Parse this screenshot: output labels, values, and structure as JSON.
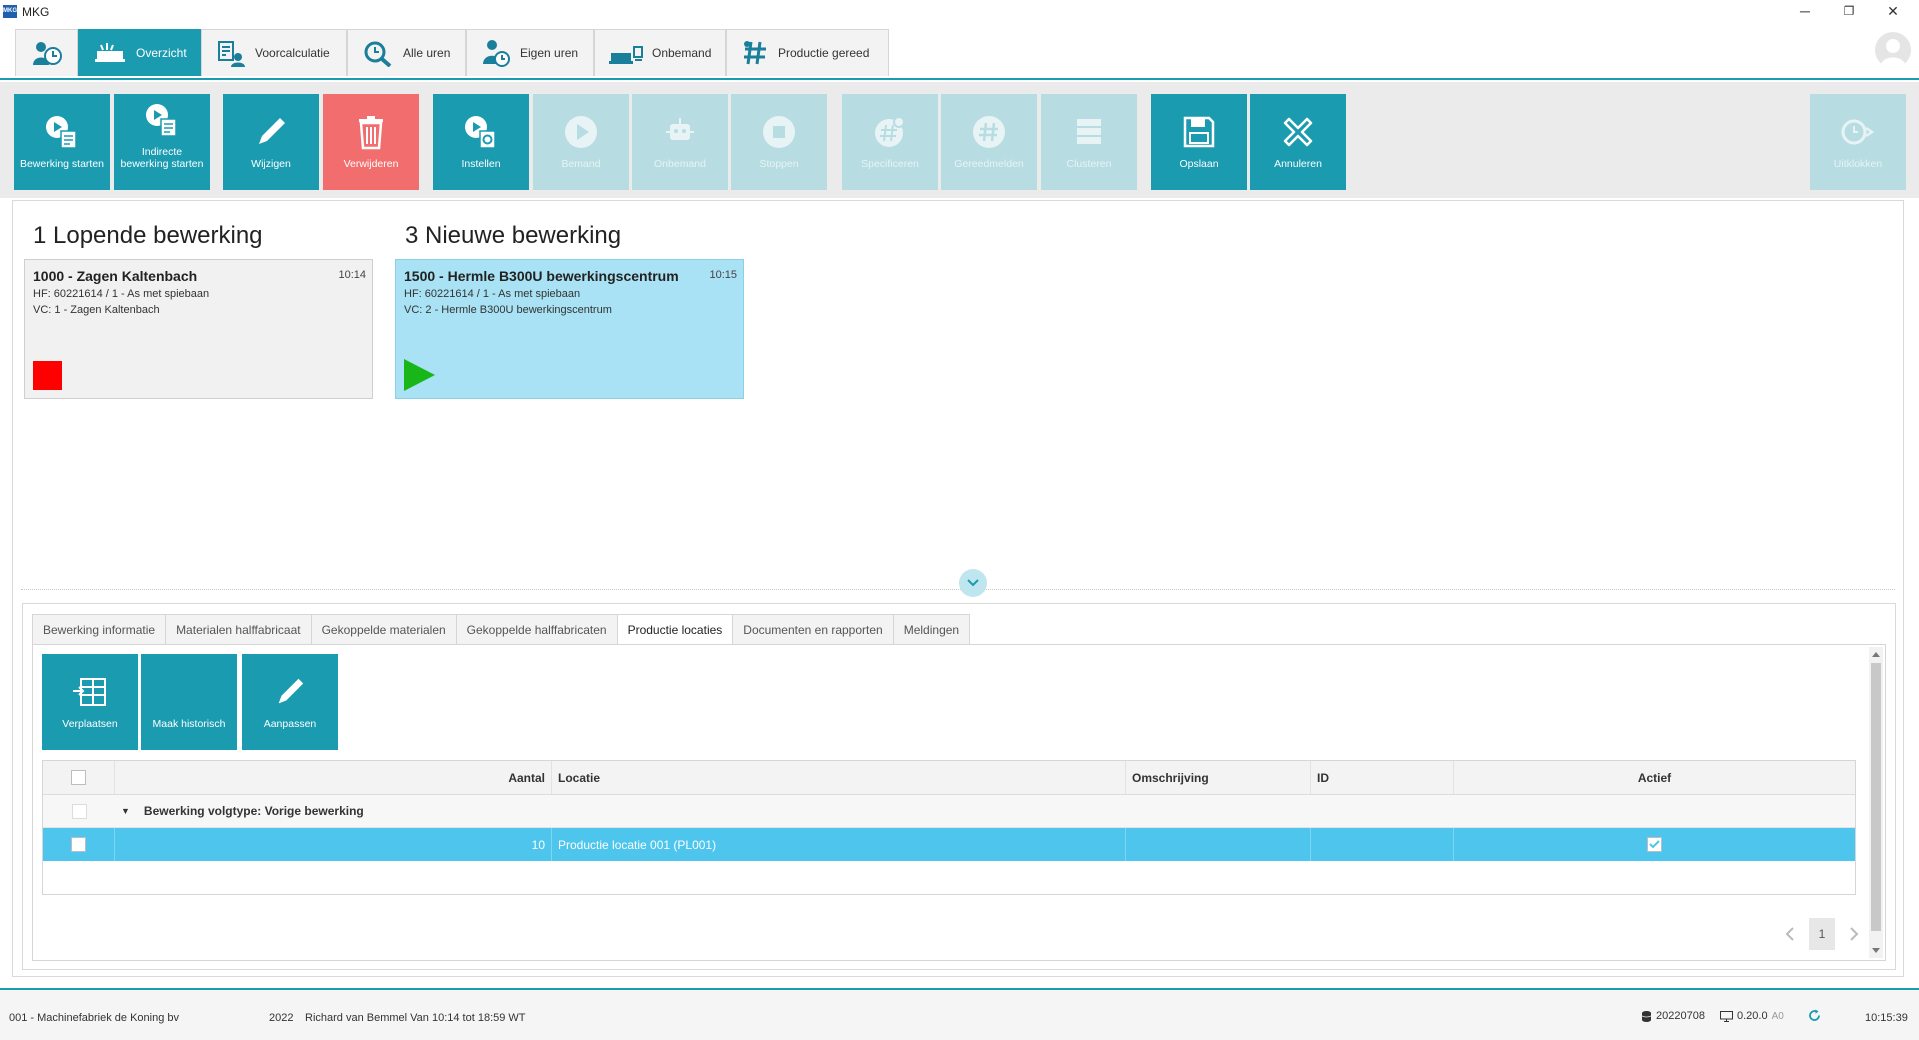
{
  "window": {
    "logo_text": "MKG",
    "title": "MKG",
    "min_glyph": "─",
    "restore_glyph": "❐",
    "close_glyph": "✕"
  },
  "module_tabs": [
    {
      "label": "",
      "icon": "clock-user-icon"
    },
    {
      "label": "Overzicht",
      "icon": "machine-icon"
    },
    {
      "label": "Voorcalculatie",
      "icon": "calculator-user-icon"
    },
    {
      "label": "Alle uren",
      "icon": "search-clock-icon"
    },
    {
      "label": "Eigen uren",
      "icon": "user-clock-icon"
    },
    {
      "label": "Onbemand",
      "icon": "robot-machine-icon"
    },
    {
      "label": "Productie gereed",
      "icon": "hash-icon"
    }
  ],
  "toolbar": {
    "bewerking_starten": "Bewerking starten",
    "indirecte_line1": "Indirecte",
    "indirecte_line2": "bewerking starten",
    "wijzigen": "Wijzigen",
    "verwijderen": "Verwijderen",
    "instellen": "Instellen",
    "bemand": "Bemand",
    "onbemand": "Onbemand",
    "stoppen": "Stoppen",
    "specificeren": "Specificeren",
    "gereedmelden": "Gereedmelden",
    "clusteren": "Clusteren",
    "opslaan": "Opslaan",
    "annuleren": "Annuleren",
    "uitklokken": "Uitklokken"
  },
  "lopende": {
    "heading": "1 Lopende bewerking",
    "card": {
      "title": "1000 - Zagen Kaltenbach",
      "time": "10:14",
      "hf": "HF: 60221614 / 1 - As met spiebaan",
      "vc": "VC: 1 - Zagen Kaltenbach"
    }
  },
  "nieuwe": {
    "heading": "3 Nieuwe bewerking",
    "card": {
      "title": "1500 - Hermle B300U bewerkingscentrum",
      "time": "10:15",
      "hf": "HF: 60221614 / 1 - As met spiebaan",
      "vc": "VC: 2 - Hermle B300U bewerkingscentrum"
    }
  },
  "detail_tabs": [
    "Bewerking informatie",
    "Materialen halffabricaat",
    "Gekoppelde materialen",
    "Gekoppelde halffabricaten",
    "Productie locaties",
    "Documenten en rapporten",
    "Meldingen"
  ],
  "sub_toolbar": {
    "verplaatsen": "Verplaatsen",
    "maak_historisch": "Maak historisch",
    "aanpassen": "Aanpassen"
  },
  "grid": {
    "columns": {
      "aantal": "Aantal",
      "locatie": "Locatie",
      "omschrijving": "Omschrijving",
      "id": "ID",
      "actief": "Actief"
    },
    "group_label": "Bewerking volgtype: Vorige bewerking",
    "rows": [
      {
        "aantal": "10",
        "locatie": "Productie locatie 001 (PL001)",
        "omschrijving": "",
        "id": "",
        "actief": true
      }
    ]
  },
  "pager": {
    "page": "1"
  },
  "status": {
    "company": "001 - Machinefabriek de Koning bv",
    "year": "2022",
    "user_info": "Richard van Bemmel Van 10:14 tot 18:59 WT",
    "db_version": "20220708",
    "app_version": "0.20.0",
    "app_version_suffix": "A0",
    "clock": "10:15:39"
  },
  "colors": {
    "accent": "#1a9bb0",
    "delete": "#f26e6e",
    "disabled": "#b7dde3",
    "selected_card": "#a8e2f4",
    "selected_row": "#4dc5ec",
    "stop": "#ff0000",
    "play": "#19b619"
  }
}
